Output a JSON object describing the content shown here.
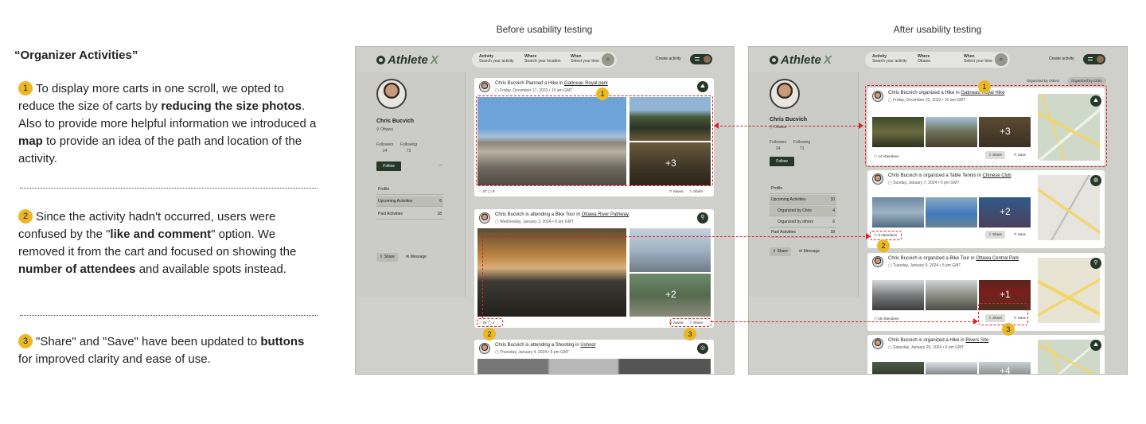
{
  "left": {
    "heading": "“Organizer Activities”",
    "notes": [
      {
        "badge": "1",
        "parts": [
          "To display more carts in one scroll, we opted to reduce the size of carts by ",
          "reducing the size photos",
          ". Also to provide more helpful information we introduced a ",
          "map",
          " to provide an idea of the path and location of the activity."
        ]
      },
      {
        "badge": "2",
        "parts": [
          "Since the activity hadn't occurred, users were confused by the \"",
          "like and comment",
          "\" option. We removed it from the cart and focused on showing the ",
          "number of attendees",
          " and available spots instead."
        ]
      },
      {
        "badge": "3",
        "parts": [
          "\"Share\" and \"Save\" have been updated to ",
          "buttons",
          " for improved clarity and ease of use."
        ]
      }
    ]
  },
  "columns": {
    "before": "Before usability testing",
    "after": "After usability testing"
  },
  "app": {
    "logo_a": "Athlete",
    "logo_b": "X",
    "search": [
      {
        "label": "Activity",
        "hint": "Search your activity"
      },
      {
        "label": "Where",
        "hint": "Search your location"
      },
      {
        "label": "When",
        "hint": "Select your time"
      }
    ],
    "create": "Create activity",
    "profile": {
      "name": "Chris Bucvich",
      "location": "Ottawa",
      "followers_label": "Followers",
      "followers": "24",
      "following_label": "Following",
      "following": "73",
      "follow": "Follow",
      "more": "...",
      "share": "Share",
      "message": "Message"
    },
    "before_menu": [
      {
        "label": "Profile",
        "count": ""
      },
      {
        "label": "Upcoming Activities",
        "count": "6"
      },
      {
        "label": "Past Activities",
        "count": "18"
      }
    ],
    "after_menu": [
      {
        "label": "Profile",
        "count": ""
      },
      {
        "label": "Upcoming Activities",
        "count": "10"
      },
      {
        "label": "Organized by Chris",
        "count": "4"
      },
      {
        "label": "Organized by others",
        "count": "6"
      },
      {
        "label": "Past Activities",
        "count": "18"
      }
    ],
    "after_tabs": [
      "Organized by Others",
      "Organized by Chris"
    ]
  },
  "before_cards": [
    {
      "title": "Chris Bucvich Planned a Hike in ",
      "place": "Gatineau Royal park",
      "date": "Friday, December 17, 2023  •  10 am GMT",
      "likes": "37",
      "comments": "8",
      "saved": "Saved",
      "share": "Share",
      "more": "+3",
      "icon": "hike-icon"
    },
    {
      "title": "Chris Bucvich is attending a Bike Tour in ",
      "place": "Ottawa River Pathway",
      "date": "Wednesday, January 3, 2024  •  9 am GMT",
      "likes": "35",
      "comments": "3",
      "saved": "Saved",
      "share": "Share",
      "more": "+2",
      "icon": "bike-icon"
    },
    {
      "title": "Chris Bucvich is attending a Shooting in ",
      "place": "Ushoot",
      "date": "Thursday, January 4, 2024  •  5 pm GMT",
      "icon": "target-icon"
    }
  ],
  "after_cards": [
    {
      "title": "Chris Bucvich organized a Hike in ",
      "place": "Gatineau Royal Hike",
      "date": "Friday, December 22, 2023  •  10 am GMT",
      "attendees": "14 Attendees",
      "share": "Share",
      "save": "Save",
      "more": "+3"
    },
    {
      "title": "Chris Bucvich is organized a Table Tennis in ",
      "place": "Chinese Club",
      "date": "Sunday, January 7, 2024  •  6 pm GMT",
      "attendees": "8 Attendees",
      "share": "Share",
      "save": "Save",
      "more": "+2"
    },
    {
      "title": "Chris Bucvich is organized a Bike Tour in ",
      "place": "Ottawa Central Park",
      "date": "Tuesday, January 9, 2024  •  5 pm GMT",
      "attendees": "28 Attendees",
      "share": "Share",
      "save": "Save",
      "more": "+1"
    },
    {
      "title": "Chris Bucvich is organized a Hike in ",
      "place": "Rivers Site",
      "date": "Saturday, January 20, 2024  •  6 pm GMT",
      "more": "+4"
    }
  ],
  "markers": [
    "1",
    "2",
    "3"
  ],
  "colors": {
    "accent": "#27382b",
    "badge": "#e9b824",
    "annotation": "#e02020",
    "panel": "#cfd0cb"
  }
}
